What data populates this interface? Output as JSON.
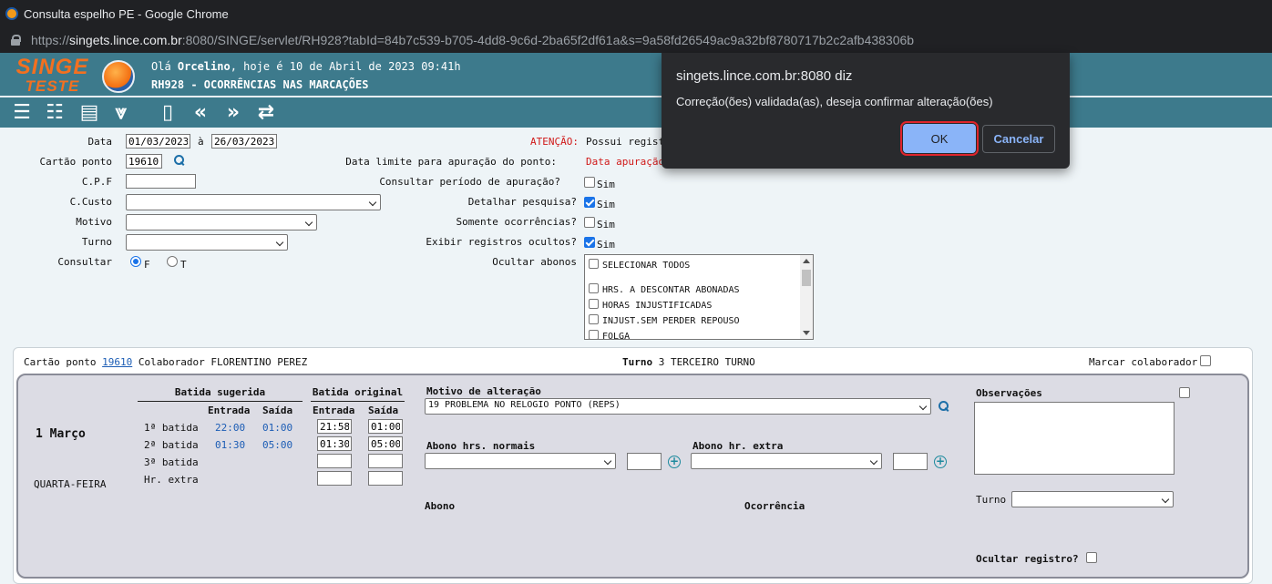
{
  "browser": {
    "window_title": "Consulta espelho PE - Google Chrome",
    "url_scheme": "https://",
    "url_host": "singets.lince.com.br",
    "url_rest": ":8080/SINGE/servlet/RH928?tabId=84b7c539-b705-4dd8-9c6d-2ba65f2df61a&s=9a58fd26549ac9a32bf8780717b2c2afb438306b"
  },
  "header": {
    "logo_line1": "SINGE",
    "logo_line2": "TESTE",
    "greeting_prefix": "Olá ",
    "user": "Orcelino",
    "greeting_suffix": ", hoje é 10 de Abril de 2023 09:41h",
    "page_title": "RH928 - OCORRÊNCIAS NAS MARCAÇÕES",
    "accent_color": "#3d7a8c"
  },
  "toolbar": {
    "icons": [
      "list-icon",
      "checklist-icon",
      "card-icon",
      "collapse-icon",
      "book-icon",
      "previous-icon",
      "next-icon",
      "refresh-icon"
    ]
  },
  "filters": {
    "data_label": "Data",
    "data_from": "01/03/2023",
    "data_sep": "à",
    "data_to": "26/03/2023",
    "cartao_label": "Cartão ponto",
    "cartao_value": "19610",
    "cpf_label": "C.P.F",
    "ccusto_label": "C.Custo",
    "motivo_label": "Motivo",
    "turno_label": "Turno",
    "consultar_label": "Consultar",
    "consultar_opt_f": "F",
    "consultar_opt_t": "T",
    "atencao_label": "ATENÇÃO:",
    "atencao_text": "Possui regist",
    "data_limite_label": "Data limite para apuração do ponto:",
    "data_limite_value": "Data apuração",
    "consultar_periodo_label": "Consultar período de apuração?",
    "detalhar_label": "Detalhar pesquisa?",
    "somente_label": "Somente ocorrências?",
    "exibir_label": "Exibir registros ocultos?",
    "sim": "Sim",
    "ocultar_abonos_label": "Ocultar abonos",
    "abonos_options": [
      "SELECIONAR TODOS",
      "HRS. A DESCONTAR ABONADAS",
      "HORAS INJUSTIFICADAS",
      "INJUST.SEM PERDER REPOUSO",
      "FOLGA"
    ]
  },
  "record": {
    "cartao_label": "Cartão ponto",
    "cartao_value": "19610",
    "colaborador_label": "Colaborador",
    "colaborador_name": "FLORENTINO PEREZ",
    "turno_label": "Turno",
    "turno_value": "3 TERCEIRO TURNO",
    "marcar_label": "Marcar colaborador",
    "day": "1 Março",
    "weekday": "QUARTA-FEIRA",
    "sugerida_header": "Batida sugerida",
    "original_header": "Batida original",
    "entrada": "Entrada",
    "saida": "Saída",
    "row_labels": [
      "1ª batida",
      "2ª batida",
      "3ª batida",
      "Hr. extra"
    ],
    "sugerida": [
      [
        "22:00",
        "01:00"
      ],
      [
        "01:30",
        "05:00"
      ]
    ],
    "original": [
      [
        "21:58",
        "01:00"
      ],
      [
        "01:30",
        "05:00"
      ],
      [
        "",
        ""
      ],
      [
        "",
        ""
      ]
    ],
    "motivo_label": "Motivo de alteração",
    "motivo_value": "19 PROBLEMA NO RELOGIO PONTO (REPS)",
    "abono_normais_label": "Abono hrs. normais",
    "abono_extra_label": "Abono hr. extra",
    "abono_col": "Abono",
    "ocorrencia_col": "Ocorrência",
    "observacoes_label": "Observações",
    "turno_select_label": "Turno",
    "ocultar_registro_label": "Ocultar registro?"
  },
  "dialog": {
    "title": "singets.lince.com.br:8080 diz",
    "message": "Correção(ões) validada(as), deseja confirmar alteração(ões)",
    "ok": "OK",
    "cancel": "Cancelar"
  }
}
